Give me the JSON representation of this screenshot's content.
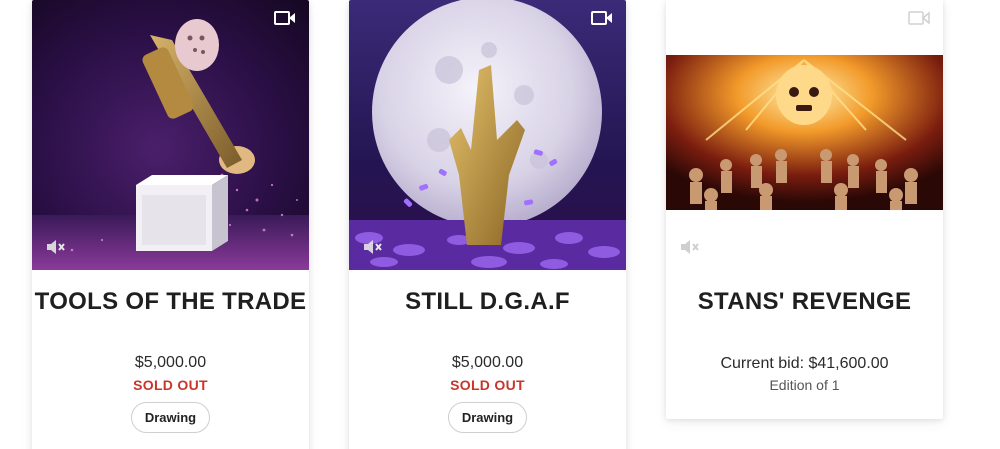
{
  "cards": [
    {
      "title": "TOOLS OF THE TRADE",
      "price": "$5,000.00",
      "status": "SOLD OUT",
      "tag": "Drawing",
      "media_icons": [
        "video-icon",
        "muted-speaker-icon"
      ]
    },
    {
      "title": "STILL D.G.A.F",
      "price": "$5,000.00",
      "status": "SOLD OUT",
      "tag": "Drawing",
      "media_icons": [
        "video-icon",
        "muted-speaker-icon"
      ]
    },
    {
      "title": "STANS' REVENGE",
      "current_bid": "Current bid: $41,600.00",
      "edition": "Edition of 1",
      "media_icons": [
        "video-icon",
        "muted-speaker-icon"
      ]
    }
  ],
  "colors": {
    "status_red": "#c9352b",
    "title_text": "#1f1f1f"
  }
}
